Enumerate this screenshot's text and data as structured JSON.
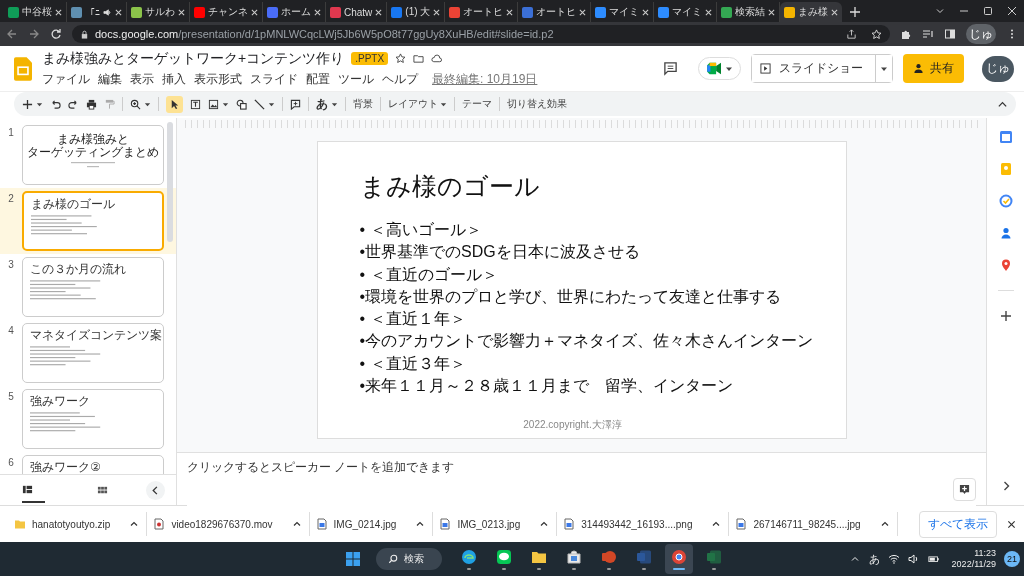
{
  "browser": {
    "tabs": [
      {
        "title": "中谷桜",
        "color": "#0f9d58",
        "audio": false,
        "selected": false
      },
      {
        "title": "「ﾆ",
        "color": "#5f8fb0",
        "audio": true,
        "selected": false
      },
      {
        "title": "サルわ",
        "color": "#8bc34a",
        "audio": false,
        "selected": false
      },
      {
        "title": "チャンネ",
        "color": "#ff0000",
        "audio": false,
        "selected": false
      },
      {
        "title": "ホーム",
        "color": "#4a6cf7",
        "audio": false,
        "selected": false
      },
      {
        "title": "Chatw",
        "color": "#e0384f",
        "audio": false,
        "selected": false
      },
      {
        "title": "(1) 大",
        "color": "#1877f2",
        "audio": false,
        "selected": false
      },
      {
        "title": "オートヒ",
        "color": "#ea4335",
        "audio": false,
        "selected": false
      },
      {
        "title": "オートヒ",
        "color": "#3b6fd6",
        "audio": false,
        "selected": false
      },
      {
        "title": "マイミ",
        "color": "#2d8cff",
        "audio": false,
        "selected": false
      },
      {
        "title": "マイミ",
        "color": "#2d8cff",
        "audio": false,
        "selected": false
      },
      {
        "title": "検索結",
        "color": "#34a853",
        "audio": false,
        "selected": false
      },
      {
        "title": "まみ様",
        "color": "#f4b400",
        "audio": false,
        "selected": true
      }
    ],
    "address": {
      "host": "docs.google.com",
      "path": "/presentation/d/1pMNLWCqcLWj5Jb6W5pO8t77ggUy8XuHB/edit#slide=id.p2"
    },
    "profile": "じゅ"
  },
  "doc": {
    "title": "まみ様強みとターゲットワーク+コンテンツ作り",
    "format_badge": ".PPTX",
    "menus": [
      "ファイル",
      "編集",
      "表示",
      "挿入",
      "表示形式",
      "スライド",
      "配置",
      "ツール",
      "ヘルプ"
    ],
    "last_edit": "最終編集: 10月19日",
    "slideshow_button": "スライドショー",
    "share_button": "共有",
    "avatar": "じゅ"
  },
  "toolbar": {
    "font_menu": "あ",
    "buttons": [
      {
        "label": "背景",
        "dropdown": false
      },
      {
        "label": "レイアウト",
        "dropdown": true
      },
      {
        "label": "テーマ",
        "dropdown": false
      },
      {
        "label": "切り替え効果",
        "dropdown": false
      }
    ]
  },
  "slides": [
    {
      "number": "1",
      "kind": "title",
      "title_lines": [
        "まみ様強みと",
        "ターゲッティングまとめ"
      ],
      "selected": false
    },
    {
      "number": "2",
      "kind": "content",
      "title": "まみ様のゴール",
      "selected": true
    },
    {
      "number": "3",
      "kind": "content",
      "title": "この３か月の流れ",
      "selected": false
    },
    {
      "number": "4",
      "kind": "content",
      "title": "マネタイズコンテンツ案",
      "selected": false
    },
    {
      "number": "5",
      "kind": "content",
      "title": "強みワーク",
      "selected": false
    },
    {
      "number": "6",
      "kind": "content",
      "title": "強みワーク②",
      "selected": false
    }
  ],
  "slide": {
    "title": "まみ様のゴール",
    "bullets": [
      "• ＜高いゴール＞",
      "•世界基準でのSDGを日本に波及させる",
      "• ＜直近のゴール＞",
      "•環境を世界のプロと学び、世界にわたって友達と仕事する",
      "• ＜直近１年＞",
      "•今のアカウントで影響力＋マネタイズ、佐々木さんインターン",
      "• ＜直近３年＞",
      "•来年１１月～２８歳１１月まで　留学、インターン"
    ],
    "footer": "2022.copyright.大澤淳"
  },
  "notes": {
    "placeholder": "クリックするとスピーカー ノートを追加できます"
  },
  "downloads": {
    "files": [
      {
        "kind": "zip",
        "name": "hanatotyoutyo.zip"
      },
      {
        "kind": "video",
        "name": "video1829676370.mov"
      },
      {
        "kind": "image",
        "name": "IMG_0214.jpg"
      },
      {
        "kind": "image",
        "name": "IMG_0213.jpg"
      },
      {
        "kind": "image",
        "name": "314493442_16193....png"
      },
      {
        "kind": "image",
        "name": "267146711_98245....jpg"
      }
    ],
    "show_all": "すべて表示"
  },
  "taskbar": {
    "search": "検索",
    "apps": [
      {
        "kind": "edge",
        "selected": false
      },
      {
        "kind": "line",
        "selected": false
      },
      {
        "kind": "explorer",
        "selected": false
      },
      {
        "kind": "store",
        "selected": false
      },
      {
        "kind": "powerpoint",
        "selected": false
      },
      {
        "kind": "word",
        "selected": false
      },
      {
        "kind": "chrome",
        "selected": true
      },
      {
        "kind": "excel",
        "selected": false
      }
    ],
    "ime": "あ",
    "time": "11:23",
    "date": "2022/11/29",
    "notifications": "21"
  }
}
